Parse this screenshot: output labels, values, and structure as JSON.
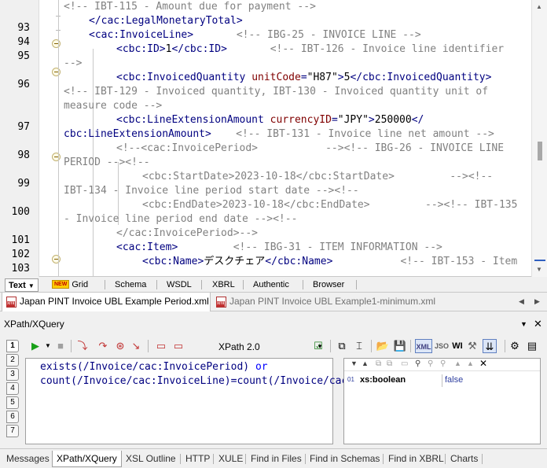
{
  "editor": {
    "line_numbers": [
      "93",
      "94",
      "95",
      "96",
      "97",
      "98",
      "99",
      "100",
      "101",
      "102",
      "103"
    ],
    "lines": [
      [
        {
          "c": "cm",
          "t": "<!-- IBT-115 - Amount due for payment -->"
        }
      ],
      [
        {
          "c": "tg",
          "t": "</cac:LegalMonetaryTotal>"
        }
      ],
      [
        {
          "c": "tg",
          "t": "<cac:InvoiceLine>"
        },
        {
          "c": "tx",
          "t": "       "
        },
        {
          "c": "cm",
          "t": "<!-- IBG-25 - INVOICE LINE -->"
        }
      ],
      [
        {
          "c": "tg",
          "t": "<cbc:ID>"
        },
        {
          "c": "tx",
          "t": "1"
        },
        {
          "c": "tg",
          "t": "</cbc:ID>"
        },
        {
          "c": "tx",
          "t": "       "
        },
        {
          "c": "cm",
          "t": "<!-- IBT-126 - Invoice line identifier"
        }
      ],
      [
        {
          "c": "cm",
          "t": "-->"
        }
      ],
      [
        {
          "c": "tg",
          "t": "<cbc:InvoicedQuantity "
        },
        {
          "c": "an",
          "t": "unitCode"
        },
        {
          "c": "tg",
          "t": "="
        },
        {
          "c": "av",
          "t": "\"H87\""
        },
        {
          "c": "tg",
          "t": ">"
        },
        {
          "c": "tx",
          "t": "5"
        },
        {
          "c": "tg",
          "t": "</cbc:InvoicedQuantity>"
        }
      ],
      [
        {
          "c": "cm",
          "t": "<!-- IBT-129 - Invoiced quantity, IBT-130 - Invoiced quantity unit of"
        }
      ],
      [
        {
          "c": "cm",
          "t": "measure code -->"
        }
      ],
      [
        {
          "c": "tg",
          "t": "<cbc:LineExtensionAmount "
        },
        {
          "c": "an",
          "t": "currencyID"
        },
        {
          "c": "tg",
          "t": "="
        },
        {
          "c": "av",
          "t": "\"JPY\""
        },
        {
          "c": "tg",
          "t": ">"
        },
        {
          "c": "tx",
          "t": "250000"
        },
        {
          "c": "tg",
          "t": "</"
        }
      ],
      [
        {
          "c": "tg",
          "t": "cbc:LineExtensionAmount>"
        },
        {
          "c": "tx",
          "t": "    "
        },
        {
          "c": "cm",
          "t": "<!-- IBT-131 - Invoice line net amount -->"
        }
      ],
      [
        {
          "c": "cm",
          "t": "<!--<cac:InvoicePeriod>           --><!-- IBG-26 - INVOICE LINE"
        }
      ],
      [
        {
          "c": "cm",
          "t": "PERIOD --><!--"
        }
      ],
      [
        {
          "c": "cm",
          "t": "<cbc:StartDate>2023-10-18</cbc:StartDate>         --><!--"
        }
      ],
      [
        {
          "c": "cm",
          "t": "IBT-134 - Invoice line period start date --><!--"
        }
      ],
      [
        {
          "c": "cm",
          "t": "<cbc:EndDate>2023-10-18</cbc:EndDate>         --><!-- IBT-135"
        }
      ],
      [
        {
          "c": "cm",
          "t": "- Invoice line period end date --><!--"
        }
      ],
      [
        {
          "c": "cm",
          "t": "</cac:InvoicePeriod>-->"
        }
      ],
      [
        {
          "c": "tg",
          "t": "<cac:Item>"
        },
        {
          "c": "tx",
          "t": "         "
        },
        {
          "c": "cm",
          "t": "<!-- IBG-31 - ITEM INFORMATION -->"
        }
      ],
      [
        {
          "c": "tg",
          "t": "<cbc:Name>"
        },
        {
          "c": "tx",
          "t": "デスクチェア"
        },
        {
          "c": "tg",
          "t": "</cbc:Name>"
        },
        {
          "c": "tx",
          "t": "           "
        },
        {
          "c": "cm",
          "t": "<!-- IBT-153 - Item"
        }
      ]
    ]
  },
  "view_tabs": {
    "text": "Text",
    "new_badge": "NEW",
    "grid": "Grid",
    "schema": "Schema",
    "wsdl": "WSDL",
    "xbrl": "XBRL",
    "authentic": "Authentic",
    "browser": "Browser"
  },
  "doc_tabs": [
    {
      "label": "Japan PINT Invoice UBL Example Period.xml",
      "active": true
    },
    {
      "label": "Japan PINT Invoice UBL Example1-minimum.xml",
      "active": false
    }
  ],
  "xpath_panel": {
    "title": "XPath/XQuery",
    "version": "XPath 2.0",
    "side_numbers": [
      "1",
      "2",
      "3",
      "4",
      "5",
      "6",
      "7"
    ],
    "format_buttons": {
      "xml": "XML",
      "json": "JSO",
      "wi": "WI"
    },
    "expression": {
      "p1": "exists(/Invoice/cac:InvoicePeriod) ",
      "kw1": "or",
      "p2": " count(/Invoice/cac:InvoiceLine)=count(/Invoice/cac:InvoiceLine/cac:InvoicePeriod)"
    },
    "result": {
      "index": "01",
      "type": "xs:boolean",
      "value": "false"
    }
  },
  "bottom_tabs": [
    "Messages",
    "XPath/XQuery",
    "XSL Outline",
    "HTTP",
    "XULE",
    "Find in Files",
    "Find in Schemas",
    "Find in XBRL",
    "Charts"
  ],
  "active_bottom_tab": "XPath/XQuery"
}
